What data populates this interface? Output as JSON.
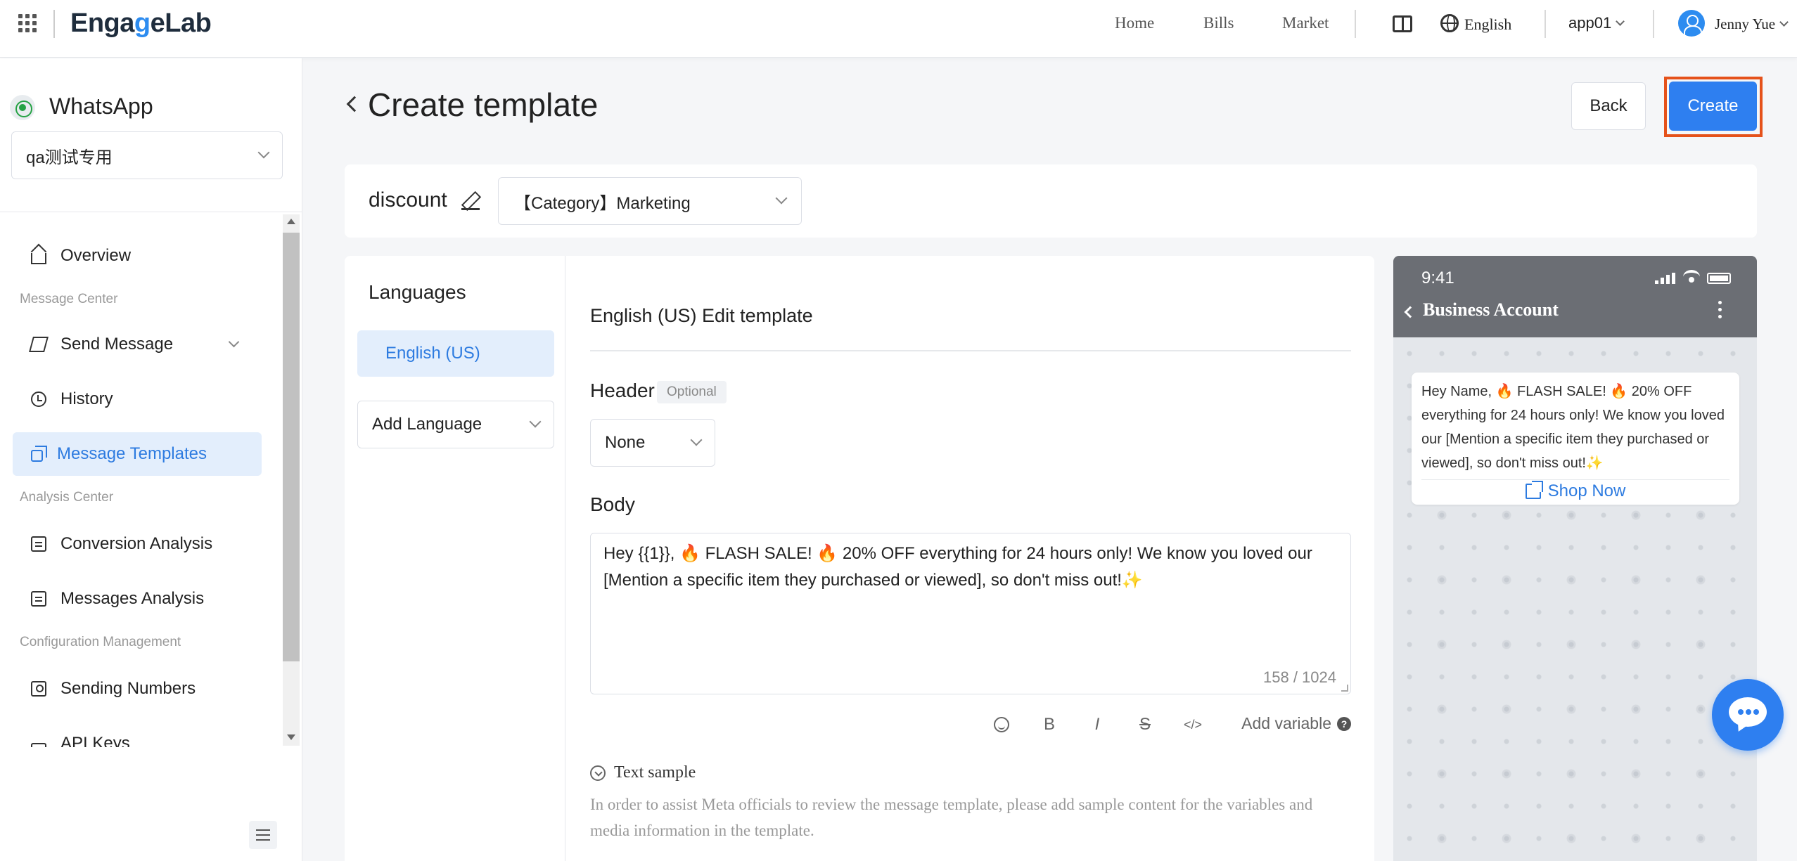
{
  "header": {
    "logo": {
      "part1": "Enga",
      "accent": "g",
      "part2": "eLab"
    },
    "nav": [
      "Home",
      "Bills",
      "Market"
    ],
    "language": "English",
    "app": "app01",
    "user": "Jenny Yue"
  },
  "sidebar": {
    "channel": "WhatsApp",
    "project": "qa测试专用",
    "groups": {
      "message_center": "Message Center",
      "analysis_center": "Analysis Center",
      "config": "Configuration Management"
    },
    "items": {
      "overview": "Overview",
      "send_message": "Send Message",
      "history": "History",
      "message_templates": "Message Templates",
      "conversion_analysis": "Conversion Analysis",
      "messages_analysis": "Messages Analysis",
      "sending_numbers": "Sending Numbers",
      "api_keys": "API Keys"
    }
  },
  "page": {
    "title": "Create template",
    "back_label": "Back",
    "create_label": "Create",
    "template_name": "discount",
    "category": "【Category】Marketing"
  },
  "languages": {
    "title": "Languages",
    "selected": "English (US)",
    "add_placeholder": "Add Language"
  },
  "editor": {
    "title": "English (US) Edit template",
    "header_label": "Header",
    "optional_tag": "Optional",
    "header_type": "None",
    "body_label": "Body",
    "body_text_line1": "Hey {{1}}, 🔥 FLASH SALE! 🔥 20% OFF everything for 24 hours only! We know you loved our",
    "body_text_line2": "[Mention a specific item they purchased or viewed], so don't miss out!✨",
    "char_count": "158 / 1024",
    "toolbar": {
      "bold": "B",
      "italic": "I",
      "strike": "S",
      "code": "</>",
      "add_variable": "Add variable",
      "help": "?"
    },
    "sample_toggle": "Text sample",
    "sample_desc": "In order to assist Meta officials to review the message template, please add sample content for the variables and media information in the template."
  },
  "preview": {
    "time": "9:41",
    "account": "Business Account",
    "message": "Hey Name, 🔥 FLASH SALE! 🔥 20% OFF everything for 24 hours only! We know you loved our [Mention a specific item they purchased or viewed], so don't miss out!✨",
    "button": "Shop Now"
  },
  "colors": {
    "primary": "#2e7ff0",
    "highlight": "#e5521b",
    "active_bg": "#e3eefc"
  }
}
